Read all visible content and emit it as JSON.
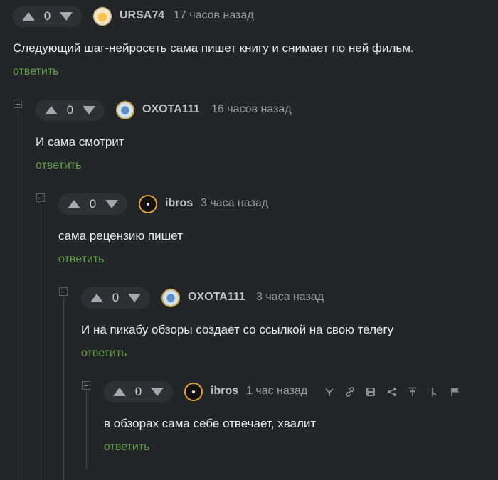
{
  "reply_label": "ответить",
  "comments": [
    {
      "score": "0",
      "author": "URSA74",
      "time": "17 часов назад",
      "text": "Следующий шаг-нейросеть сама пишет книгу и снимает по ней фильм."
    },
    {
      "score": "0",
      "author": "OXOTA111",
      "time": "16 часов назад",
      "text": "И сама смотрит"
    },
    {
      "score": "0",
      "author": "ibros",
      "time": "3 часа назад",
      "text": "сама рецензию пишет"
    },
    {
      "score": "0",
      "author": "OXOTA111",
      "time": "3 часа назад",
      "text": "И на пикабу обзоры создает со ссылкой на свою телегу"
    },
    {
      "score": "0",
      "author": "ibros",
      "time": "1 час назад",
      "text": "в обзорах сама себе отвечает, хвалит"
    }
  ],
  "actions": [
    "branch-icon",
    "link-icon",
    "save-icon",
    "share-icon",
    "up-arrow-icon",
    "collapse-branch-icon",
    "flag-icon"
  ],
  "colors": {
    "background": "#232528",
    "reply": "#63a04a",
    "vote_bg": "#2e3033"
  }
}
